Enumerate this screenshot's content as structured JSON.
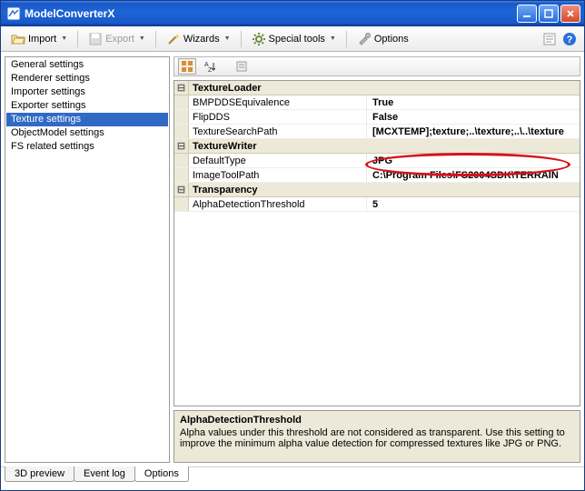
{
  "window": {
    "title": "ModelConverterX"
  },
  "toolbar": {
    "import": "Import",
    "export": "Export",
    "wizards": "Wizards",
    "special_tools": "Special tools",
    "options": "Options"
  },
  "sidebar": {
    "items": [
      {
        "label": "General settings"
      },
      {
        "label": "Renderer settings"
      },
      {
        "label": "Importer settings"
      },
      {
        "label": "Exporter settings"
      },
      {
        "label": "Texture settings"
      },
      {
        "label": "ObjectModel settings"
      },
      {
        "label": "FS related settings"
      }
    ],
    "selected_index": 4
  },
  "propgrid": {
    "categories": [
      {
        "name": "TextureLoader",
        "rows": [
          {
            "key": "BMPDDSEquivalence",
            "value": "True"
          },
          {
            "key": "FlipDDS",
            "value": "False"
          },
          {
            "key": "TextureSearchPath",
            "value": "[MCXTEMP];texture;..\\texture;..\\..\\texture"
          }
        ]
      },
      {
        "name": "TextureWriter",
        "rows": [
          {
            "key": "DefaultType",
            "value": "JPG"
          },
          {
            "key": "ImageToolPath",
            "value": "C:\\Program Files\\FS2004SDK\\TERRAIN"
          }
        ]
      },
      {
        "name": "Transparency",
        "rows": [
          {
            "key": "AlphaDetectionThreshold",
            "value": "5"
          }
        ]
      }
    ],
    "desc": {
      "title": "AlphaDetectionThreshold",
      "body": "Alpha values under this threshold are not considered as transparent. Use this setting to improve the minimum alpha value detection for compressed textures like JPG or PNG."
    }
  },
  "tabs": {
    "items": [
      {
        "label": "3D preview"
      },
      {
        "label": "Event log"
      },
      {
        "label": "Options"
      }
    ],
    "active_index": 2
  }
}
